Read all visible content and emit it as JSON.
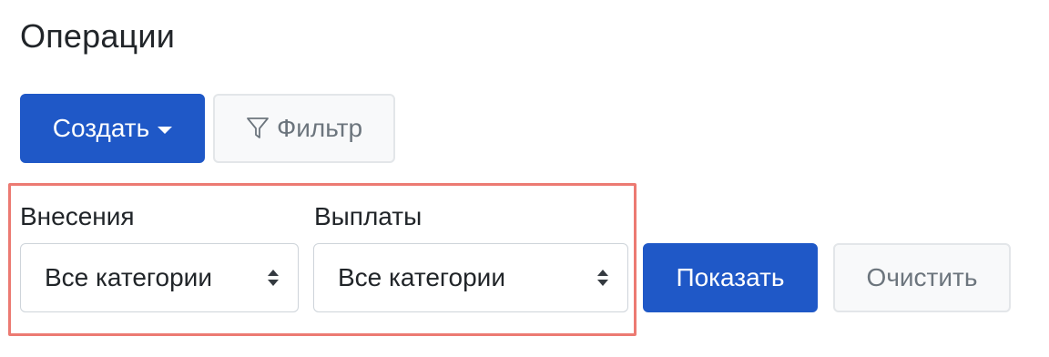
{
  "page": {
    "title": "Операции"
  },
  "toolbar": {
    "create_label": "Создать",
    "create_icon": "caret-down-icon",
    "filter_label": "Фильтр",
    "filter_icon": "funnel-icon"
  },
  "filters": {
    "income": {
      "label": "Внесения",
      "selected": "Все категории"
    },
    "expenses": {
      "label": "Выплаты",
      "selected": "Все категории"
    },
    "show_label": "Показать",
    "clear_label": "Очистить"
  },
  "colors": {
    "primary": "#1f58c7",
    "secondary_bg": "#f8f9fa",
    "secondary_text": "#6c757d",
    "highlight_border": "#ec7a72"
  }
}
